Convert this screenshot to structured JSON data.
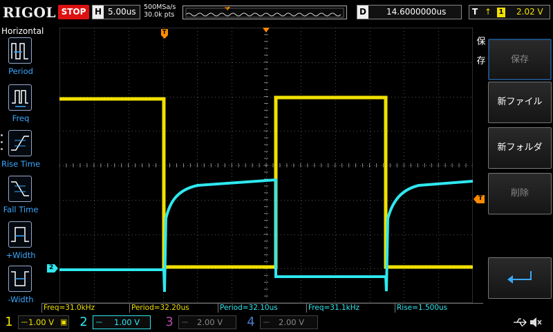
{
  "topbar": {
    "logo": "RIGOL",
    "run_status": "STOP",
    "h_label": "H",
    "timebase": "5.00us",
    "sample_rate": "500MSa/s",
    "memory_depth": "30.0k pts",
    "d_label": "D",
    "delay": "14.6000000us",
    "trig_label": "T",
    "trig_edge": "↑",
    "trig_source": "1",
    "trig_level": "2.02 V"
  },
  "left_menu": {
    "title": "Horizontal",
    "items": [
      {
        "label": "Period",
        "icon": "period-icon"
      },
      {
        "label": "Freq",
        "icon": "freq-icon"
      },
      {
        "label": "Rise Time",
        "icon": "rise-time-icon"
      },
      {
        "label": "Fall Time",
        "icon": "fall-time-icon"
      },
      {
        "label": "+Width",
        "icon": "positive-width-icon"
      },
      {
        "label": "-Width",
        "icon": "negative-width-icon"
      }
    ]
  },
  "right_menu": {
    "side_label_1": "保",
    "side_label_2": "存",
    "buttons": [
      {
        "label": "保存",
        "enabled": false
      },
      {
        "label": "新ファイル",
        "enabled": true
      },
      {
        "label": "新フォルダ",
        "enabled": true
      },
      {
        "label": "削除",
        "enabled": false
      }
    ],
    "enter_icon": "return-arrow-icon"
  },
  "measurements": [
    {
      "text": "Freq=31.0kHz",
      "channel": 1
    },
    {
      "text": "Period=32.20us",
      "channel": 1
    },
    {
      "text": "Period=32.10us",
      "channel": 2
    },
    {
      "text": "Freq=31.1kHz",
      "channel": 2
    },
    {
      "text": "Rise=1.500us",
      "channel": 2
    }
  ],
  "markers": {
    "trigger_marker": "T",
    "trigger_level_marker": "T",
    "ch2_marker": "2"
  },
  "channels": [
    {
      "num": "1",
      "scale": "1.00 V",
      "active": true
    },
    {
      "num": "2",
      "scale": "1.00 V",
      "active": true
    },
    {
      "num": "3",
      "scale": "2.00 V",
      "active": false
    },
    {
      "num": "4",
      "scale": "2.00 V",
      "active": false
    }
  ],
  "colors": {
    "ch1": "#f0e000",
    "ch2": "#2ee8f0",
    "stop": "#dd1111",
    "trigger_marker": "#ff8a00",
    "menu_label": "#3aa8ff"
  }
}
